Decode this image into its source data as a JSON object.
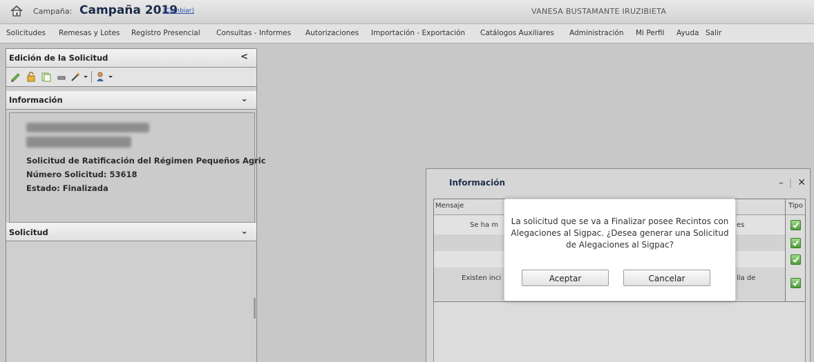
{
  "header": {
    "campaign_label": "Campaña:",
    "campaign_name": "Campaña 2019",
    "change_link": "(Cambiar)",
    "user_name": "VANESA BUSTAMANTE IRUZIBIETA"
  },
  "menu": [
    "Solicitudes",
    "Remesas y Lotes",
    "Registro Presencial",
    "Consultas - Informes",
    "Autorizaciones",
    "Importación - Exportación",
    "Catálogos Auxiliares",
    "Administración",
    "Mi Perfil",
    "Ayuda",
    "Salir"
  ],
  "left_panel": {
    "edit_title": "Edición de la Solicitud",
    "collapse_glyph": "<",
    "info_title": "Información",
    "expand_glyph": "⌄",
    "request_title": "Solicitud de Ratificación del Régimen Pequeños Agric",
    "request_number": "Número Solicitud: 53618",
    "status": "Estado: Finalizada",
    "solicitud_title": "Solicitud"
  },
  "toolbar_icons": [
    "pen-icon",
    "lock-icon",
    "copy-icon",
    "print-icon",
    "edit-icon",
    "dropdown-arrow-icon",
    "user-icon",
    "dropdown-arrow-icon"
  ],
  "info_window": {
    "title": "Información",
    "minimize": "–",
    "separator": "|",
    "close": "✕",
    "col_message": "Mensaje",
    "col_type": "Tipo",
    "rows": [
      {
        "left": "Se ha m",
        "right": "es"
      },
      {
        "left": "",
        "right": ""
      },
      {
        "left": "",
        "right": ""
      },
      {
        "left": "Existen inci",
        "right": "lla de"
      }
    ]
  },
  "modal": {
    "message": "La solicitud que se va a Finalizar posee Recintos con Alegaciones al Sigpac. ¿Desea generar una Solicitud de Alegaciones al Sigpac?",
    "accept": "Aceptar",
    "cancel": "Cancelar"
  },
  "colors": {
    "check_green": "#4f9b3c",
    "link_blue": "#2a4fb0",
    "title_navy": "#1b2b4a"
  }
}
